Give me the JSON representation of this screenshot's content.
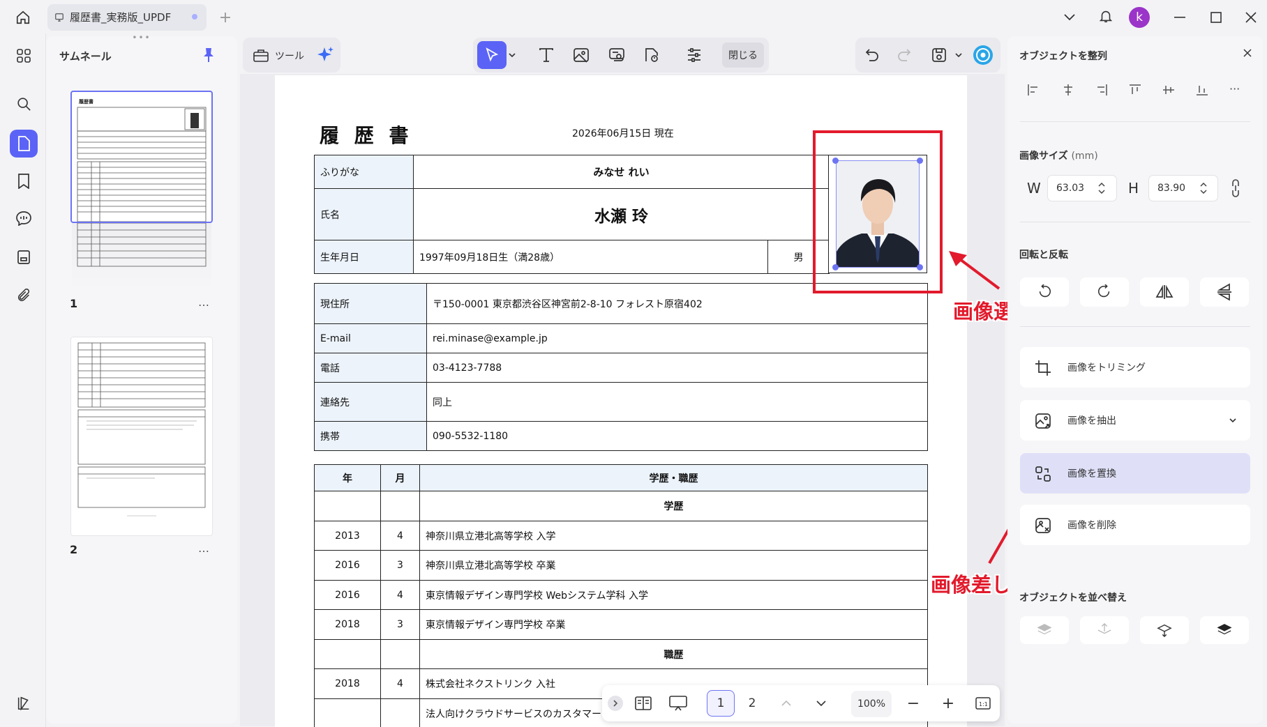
{
  "tab": {
    "title": "履歴書_実務版_UPDF",
    "avatar_letter": "k"
  },
  "thumbnails": {
    "title": "サムネール",
    "pages": [
      {
        "number": "1",
        "more": "…"
      },
      {
        "number": "2",
        "more": "…"
      }
    ]
  },
  "toolbar": {
    "tools_label": "ツール",
    "close_label": "閉じる"
  },
  "document": {
    "title": "履 歴 書",
    "date": "2026年06月15日 現在",
    "furigana_label": "ふりがな",
    "furigana_value": "みなせ れい",
    "name_label": "氏名",
    "name_value": "水瀬 玲",
    "birth_label": "生年月日",
    "birth_value": "1997年09月18日生（満28歳）",
    "gender_value": "男",
    "contacts": [
      {
        "label": "現住所",
        "value": "〒150-0001 東京都渋谷区神宮前2-8-10 フォレスト原宿402"
      },
      {
        "label": "E-mail",
        "value": "rei.minase@example.jp"
      },
      {
        "label": "電話",
        "value": "03-4123-7788"
      },
      {
        "label": "連絡先",
        "value": "同上"
      },
      {
        "label": "携帯",
        "value": "090-5532-1180"
      }
    ],
    "history_headers": {
      "year": "年",
      "month": "月",
      "detail": "学歴・職歴"
    },
    "education_heading": "学歴",
    "education": [
      {
        "year": "2013",
        "month": "4",
        "detail": "神奈川県立港北高等学校 入学"
      },
      {
        "year": "2016",
        "month": "3",
        "detail": "神奈川県立港北高等学校 卒業"
      },
      {
        "year": "2016",
        "month": "4",
        "detail": "東京情報デザイン専門学校 Webシステム学科 入学"
      },
      {
        "year": "2018",
        "month": "3",
        "detail": "東京情報デザイン専門学校 卒業"
      }
    ],
    "work_heading": "職歴",
    "work": [
      {
        "year": "2018",
        "month": "4",
        "detail": "株式会社ネクストリンク 入社"
      },
      {
        "year": "",
        "month": "",
        "detail": "法人向けクラウドサービスのカスタマー"
      }
    ]
  },
  "annotations": {
    "image_select": "画像選択",
    "image_replace": "画像差し替え"
  },
  "page_nav": {
    "page1": "1",
    "page2": "2",
    "zoom": "100%",
    "minus": "−",
    "plus": "+"
  },
  "right_panel": {
    "title": "オブジェクトを整列",
    "more": "···",
    "size_section": "画像サイズ",
    "size_unit": "(mm)",
    "w_label": "W",
    "w_value": "63.03",
    "h_label": "H",
    "h_value": "83.90",
    "rotate_section": "回転と反転",
    "actions": [
      {
        "label": "画像をトリミング"
      },
      {
        "label": "画像を抽出"
      },
      {
        "label": "画像を置換"
      },
      {
        "label": "画像を削除"
      }
    ],
    "order_section": "オブジェクトを並べ替え"
  },
  "colors": {
    "accent": "#5b63f6",
    "annotation_red": "#e21a2c",
    "label_fill": "#ecf3fb",
    "avatar": "#9b34c9"
  }
}
